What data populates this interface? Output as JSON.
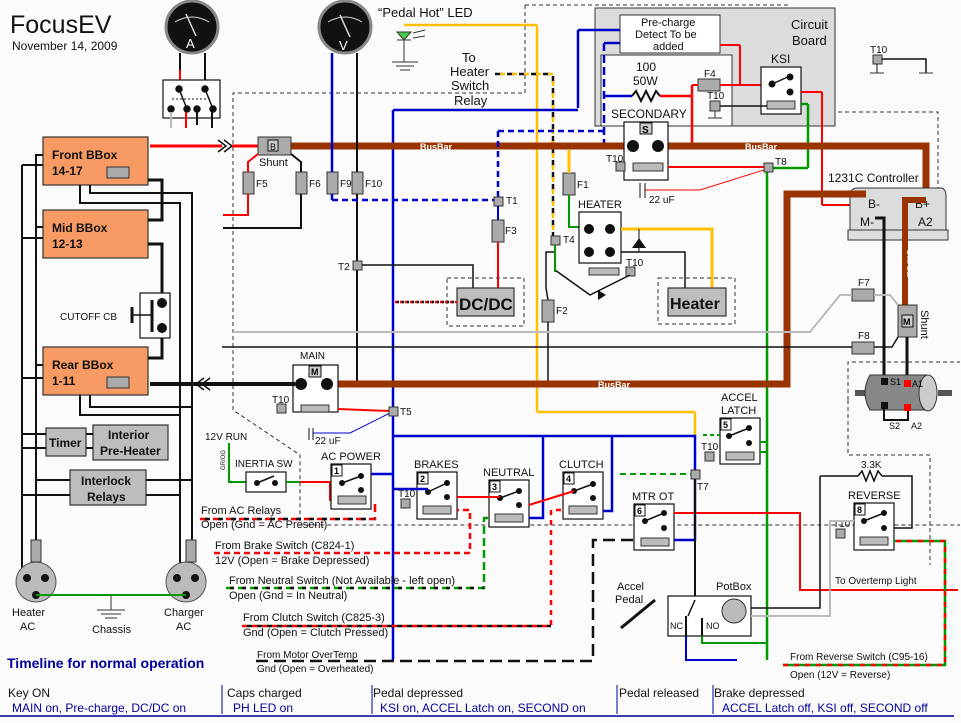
{
  "header": {
    "title": "FocusEV",
    "date": "November 14, 2009"
  },
  "meters": {
    "ammeter": "A",
    "voltmeter": "V"
  },
  "labels": {
    "pedal_hot_led": "“Pedal Hot” LED",
    "to_heater_relay": [
      "To",
      "Heater",
      "Switch",
      "Relay"
    ],
    "circuit_board": [
      "Circuit",
      "Board"
    ],
    "precharge": [
      "Pre-charge",
      "Detect To be",
      "added"
    ],
    "resistor_100": [
      "100",
      "50W"
    ],
    "secondary": "SECONDARY",
    "ksi": "KSI",
    "controller": "1231C Controller",
    "controller_terms": {
      "bminus": "B-",
      "bplus": "B+",
      "mminus": "M-",
      "a2": "A2"
    },
    "busbar": "BusBar",
    "busbar_vertical": "Bus Bar",
    "shunt": "Shunt",
    "shunt_b": "B",
    "shunt_m": "M",
    "heater_relay": "HEATER",
    "heater": "Heater",
    "dcdc": "DC/DC",
    "main": "MAIN",
    "main_m": "M",
    "secondary_s": "S",
    "cap": "22 uF",
    "cutoff": "CUTOFF CB",
    "timer": "Timer",
    "interior_preheater": [
      "Interior",
      "Pre-Heater"
    ],
    "interlock": [
      "Interlock",
      "Relays"
    ],
    "heater_ac": [
      "Heater",
      "AC"
    ],
    "charger_ac": [
      "Charger",
      "AC"
    ],
    "chassis": "Chassis",
    "v12run": "12V RUN",
    "grn_wire": "GR/OG",
    "inertia": "INERTIA SW",
    "ac_power": "AC POWER",
    "brakes": "BRAKES",
    "neutral": "NEUTRAL",
    "clutch": "CLUTCH",
    "mtr_ot": "MTR OT",
    "accel_latch": [
      "ACCEL",
      "LATCH"
    ],
    "reverse": "REVERSE",
    "r33k": "3.3K",
    "potbox": "PotBox",
    "accel_pedal": [
      "Accel",
      "Pedal"
    ],
    "nc": "NC",
    "no": "NO",
    "to_overtemp": "To Overtemp Light",
    "motor_terms": {
      "s1": "S1",
      "s2": "S2",
      "a1": "A1",
      "a2": "A2"
    }
  },
  "relay_numbers": [
    "1",
    "2",
    "3",
    "4",
    "5",
    "6",
    "8"
  ],
  "batteries": [
    {
      "name": "Front BBox",
      "cells": "14-17"
    },
    {
      "name": "Mid BBox",
      "cells": "12-13"
    },
    {
      "name": "Rear BBox",
      "cells": "1-11"
    }
  ],
  "fuses": [
    "F1",
    "F2",
    "F3",
    "F4",
    "F5",
    "F6",
    "F7",
    "F8",
    "F9",
    "F10"
  ],
  "terminals": [
    "T1",
    "T2",
    "T4",
    "T5",
    "T7",
    "T8",
    "T10"
  ],
  "inputs": [
    {
      "from": "From AC Relays",
      "state": "Open (Gnd = AC Present)"
    },
    {
      "from": "From Brake Switch (C824-1)",
      "state": "12V (Open = Brake Depressed)"
    },
    {
      "from": "From Neutral Switch (Not Available - left open)",
      "state": "Open (Gnd = In Neutral)"
    },
    {
      "from": "From Clutch Switch (C825-3)",
      "state": "Gnd (Open = Clutch Pressed)"
    },
    {
      "from": "From Motor OverTemp",
      "state": "Gnd (Open = Overheated)"
    },
    {
      "from": "From Reverse Switch (C95-16)",
      "state": "Open (12V = Reverse)"
    }
  ],
  "timeline": {
    "title": "Timeline for normal operation",
    "steps": [
      {
        "event": "Key ON",
        "result": "MAIN on, Pre-charge,  DC/DC on"
      },
      {
        "event": "Caps charged",
        "result": "PH LED on"
      },
      {
        "event": "Pedal depressed",
        "result": "KSI on, ACCEL Latch on, SECOND on"
      },
      {
        "event": "Pedal released",
        "result": ""
      },
      {
        "event": "Brake  depressed",
        "result": "ACCEL Latch off, KSI off, SECOND off"
      }
    ]
  },
  "colors": {
    "busbar": "#993300",
    "red": "#ff0000",
    "blue": "#0000cc",
    "green": "#009900",
    "yellow": "#ffc000",
    "battery": "#f79a63",
    "timeline": "#000099"
  }
}
